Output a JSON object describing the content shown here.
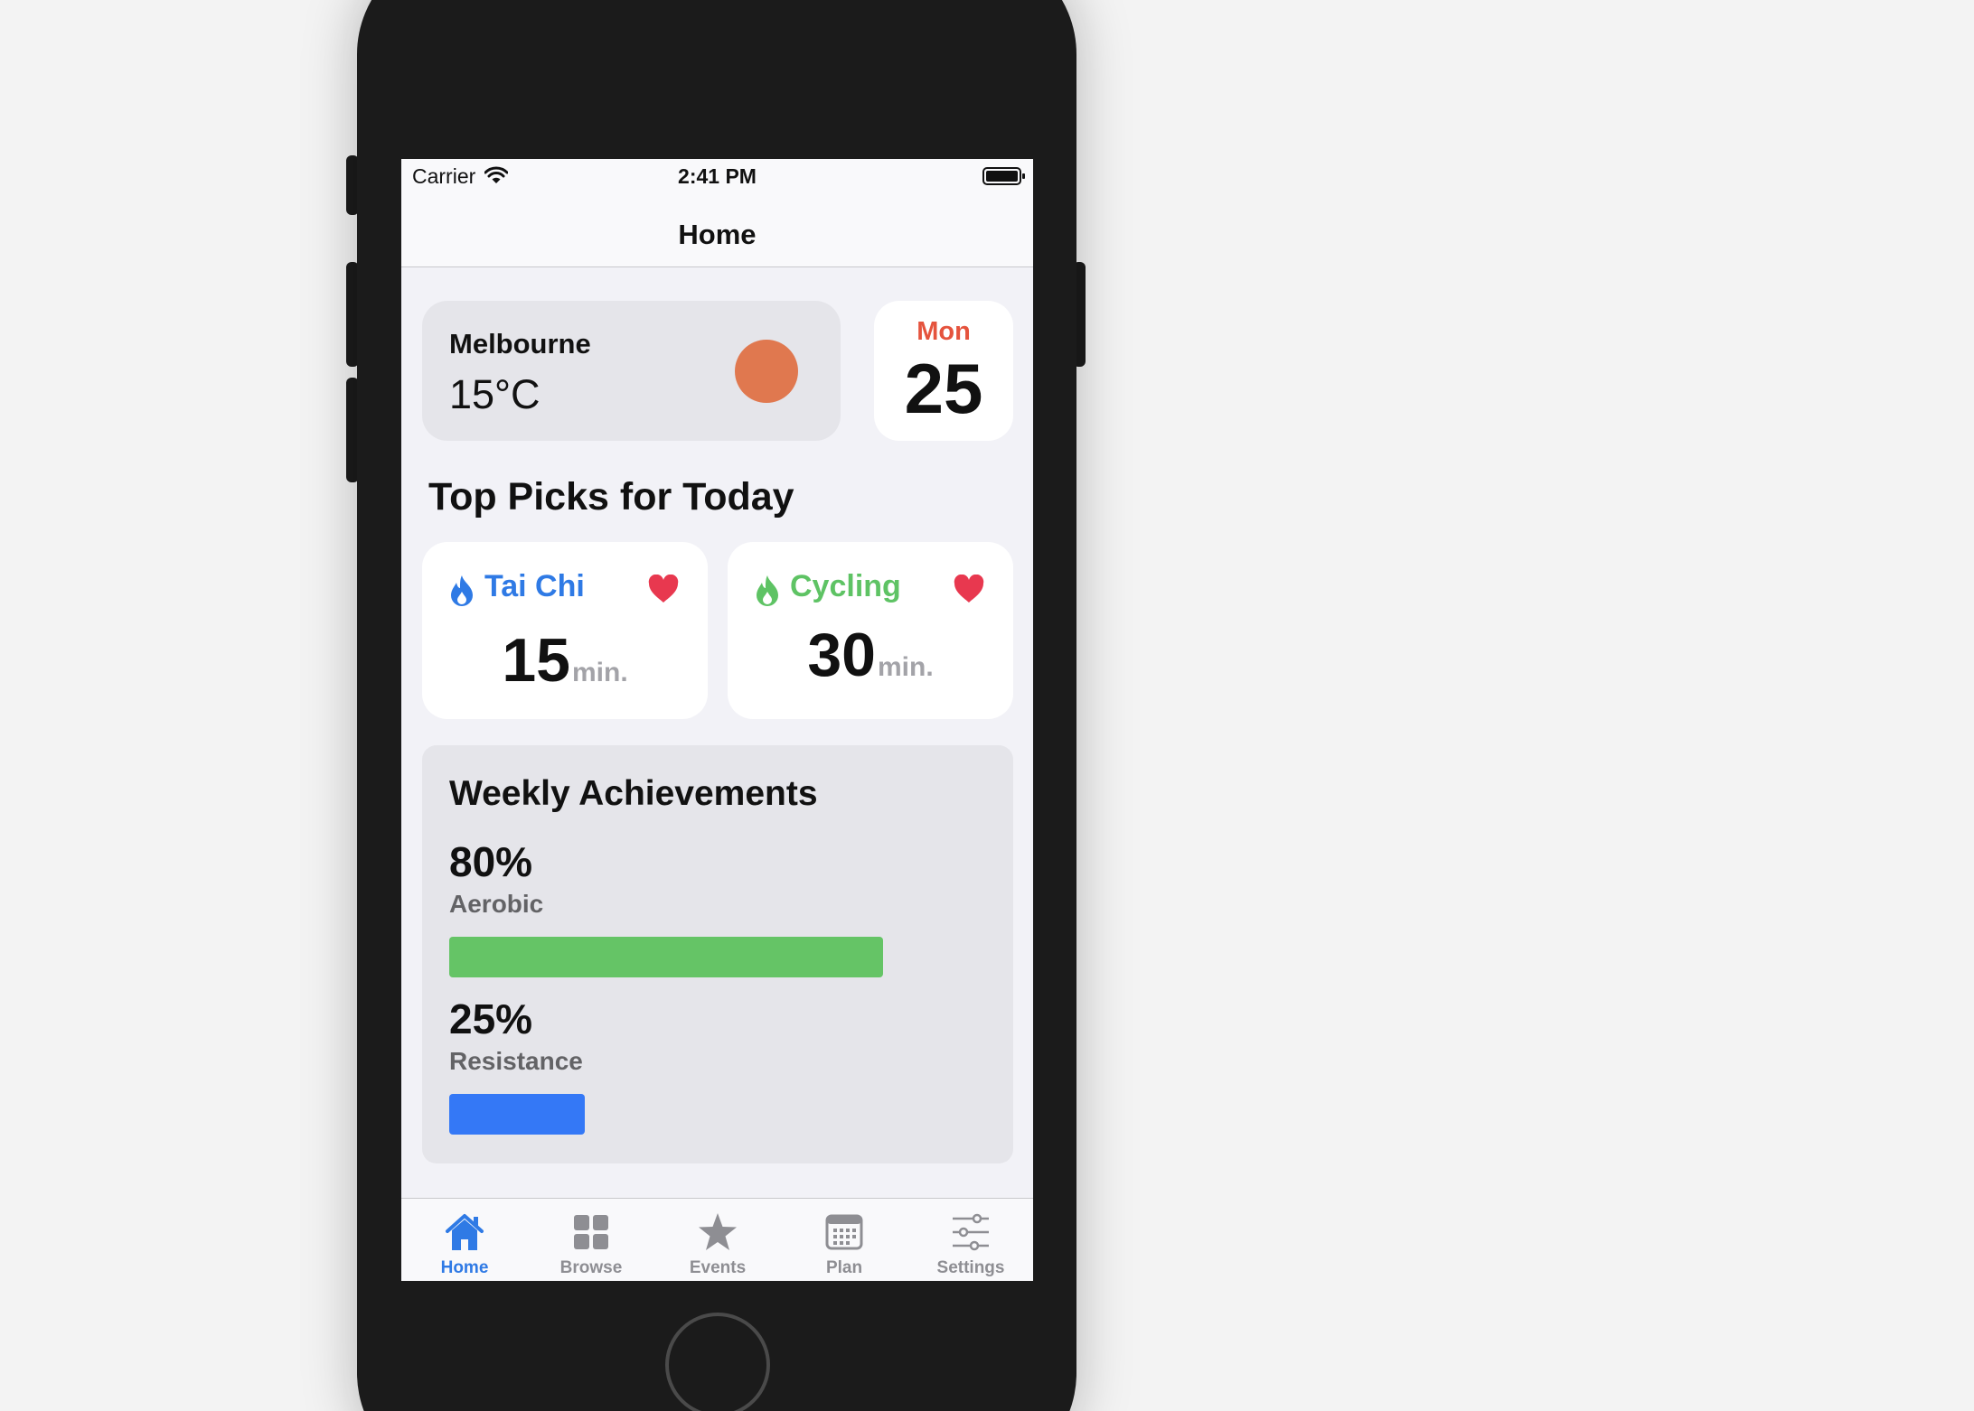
{
  "status_bar": {
    "carrier": "Carrier",
    "time": "2:41 PM"
  },
  "nav": {
    "title": "Home"
  },
  "weather": {
    "city": "Melbourne",
    "temperature": "15°C",
    "icon": "sun-icon",
    "icon_color": "#e0784f"
  },
  "date": {
    "day": "Mon",
    "number": "25"
  },
  "top_picks": {
    "title": "Top Picks for Today",
    "items": [
      {
        "name": "Tai Chi",
        "value": "15",
        "unit": "min.",
        "color": "#2f7ae5",
        "favorite": true
      },
      {
        "name": "Cycling",
        "value": "30",
        "unit": "min.",
        "color": "#5ec364",
        "favorite": true
      }
    ]
  },
  "achievements": {
    "title": "Weekly Achievements",
    "items": [
      {
        "percent_label": "80%",
        "label": "Aerobic",
        "fraction": 0.8,
        "color": "#65c466"
      },
      {
        "percent_label": "25%",
        "label": "Resistance",
        "fraction": 0.25,
        "color": "#3478f6"
      }
    ]
  },
  "tabs": [
    {
      "label": "Home",
      "icon": "house-icon",
      "active": true
    },
    {
      "label": "Browse",
      "icon": "grid-icon",
      "active": false
    },
    {
      "label": "Events",
      "icon": "star-icon",
      "active": false
    },
    {
      "label": "Plan",
      "icon": "calendar-icon",
      "active": false
    },
    {
      "label": "Settings",
      "icon": "sliders-icon",
      "active": false
    }
  ],
  "colors": {
    "accent": "#2f7ae5",
    "heart": "#e8384f",
    "date_day": "#e5533d"
  }
}
